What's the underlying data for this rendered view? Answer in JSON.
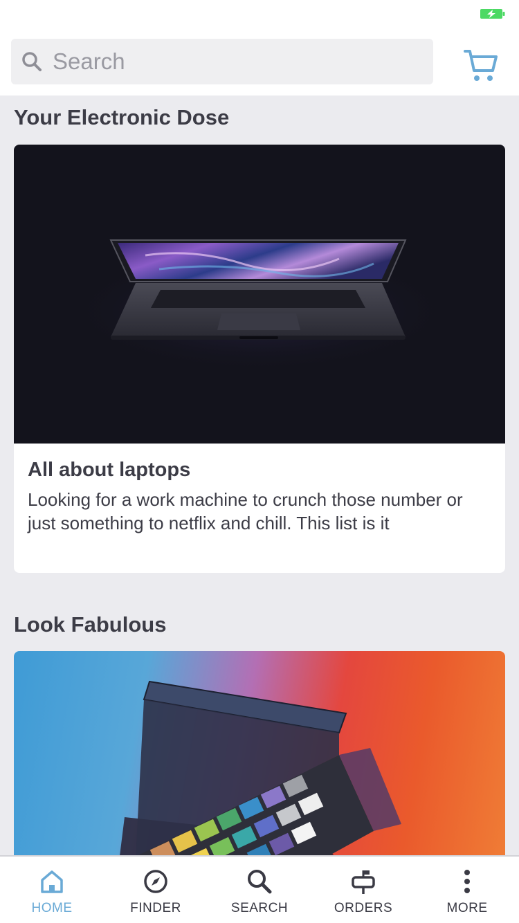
{
  "search": {
    "placeholder": "Search"
  },
  "sections": [
    {
      "title": "Your Electronic Dose",
      "card": {
        "title": "All about laptops",
        "description": "Looking for a work machine to crunch those number or just something to netflix and chill. This list is it"
      }
    },
    {
      "title": "Look Fabulous"
    }
  ],
  "tabs": [
    {
      "label": "HOME",
      "icon": "home-icon",
      "active": true
    },
    {
      "label": "FINDER",
      "icon": "compass-icon"
    },
    {
      "label": "SEARCH",
      "icon": "search-icon"
    },
    {
      "label": "ORDERS",
      "icon": "mailbox-icon"
    },
    {
      "label": "MORE",
      "icon": "more-vertical-icon"
    }
  ],
  "colors": {
    "accent": "#6aaad6",
    "battery": "#4cd964",
    "text": "#3c3c46",
    "background": "#ebebef"
  }
}
